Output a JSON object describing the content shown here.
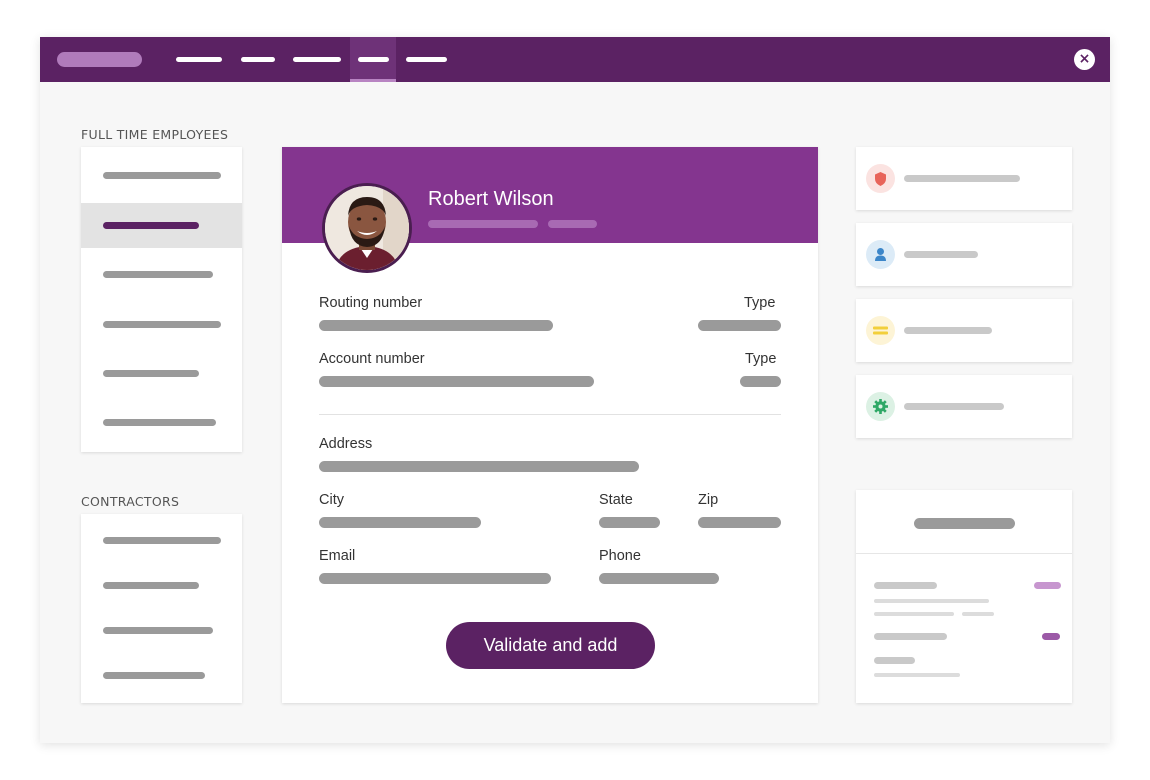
{
  "window": {
    "close_icon": "×",
    "nav_active_index": 3
  },
  "sections": {
    "full_time_label": "FULL TIME EMPLOYEES",
    "contractors_label": "CONTRACTORS"
  },
  "profile": {
    "name": "Robert Wilson"
  },
  "form": {
    "routing_number_label": "Routing number",
    "routing_type_label": "Type",
    "account_number_label": "Account number",
    "account_type_label": "Type",
    "address_label": "Address",
    "city_label": "City",
    "state_label": "State",
    "zip_label": "Zip",
    "email_label": "Email",
    "phone_label": "Phone",
    "submit_label": "Validate and add"
  },
  "colors": {
    "brand_dark": "#5b2263",
    "brand_header": "#84358f",
    "placeholder_gray": "#9a9a9a",
    "icon_red": "#e8645a",
    "icon_blue": "#3c86c9",
    "icon_yellow": "#f2cf3a",
    "icon_green": "#2fa866"
  },
  "side_icons": [
    "shield-icon",
    "user-icon",
    "card-icon",
    "gear-icon"
  ]
}
